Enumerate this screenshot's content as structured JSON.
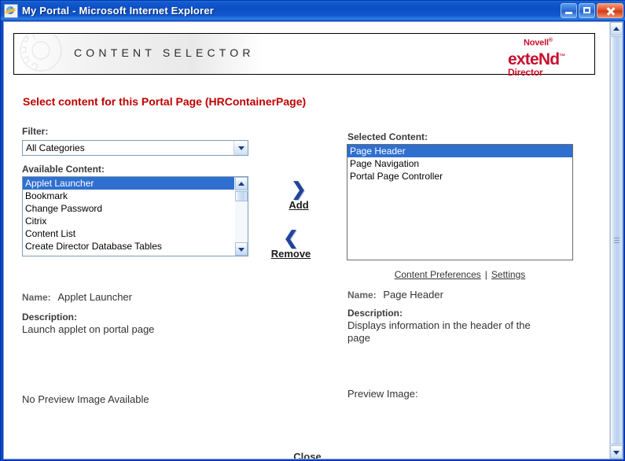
{
  "window": {
    "title": "My Portal - Microsoft Internet Explorer",
    "icon": "ie-document-icon",
    "buttons": {
      "minimize": "Minimize",
      "maximize": "Maximize",
      "close": "Close"
    }
  },
  "banner": {
    "title": "CONTENT SELECTOR",
    "logo": {
      "brand": "Novell",
      "brand_mark": "®",
      "product": "exteNd",
      "product_mark": "™",
      "suite": "Director"
    }
  },
  "heading": "Select content for this Portal Page (HRContainerPage)",
  "filter": {
    "label": "Filter:",
    "selected": "All Categories",
    "options": [
      "All Categories"
    ]
  },
  "available": {
    "label": "Available Content:",
    "items": [
      "Applet Launcher",
      "Bookmark",
      "Change Password",
      "Citrix",
      "Content List",
      "Create Director Database Tables"
    ],
    "selected_index": 0
  },
  "selected": {
    "label": "Selected Content:",
    "items": [
      "Page Header",
      "Page Navigation",
      "Portal Page Controller"
    ],
    "selected_index": 0
  },
  "transfer": {
    "add_label": "Add",
    "add_icon": "chevron-right-icon",
    "remove_label": "Remove",
    "remove_icon": "chevron-left-icon"
  },
  "links": {
    "content_preferences": "Content Preferences",
    "separator": "|",
    "settings": "Settings"
  },
  "left_detail": {
    "name_label": "Name:",
    "name_value": "Applet Launcher",
    "description_label": "Description:",
    "description_value": "Launch applet on portal page",
    "preview": "No Preview Image Available"
  },
  "right_detail": {
    "name_label": "Name:",
    "name_value": "Page Header",
    "description_label": "Description:",
    "description_value": "Displays information in the header of the page",
    "preview_label": "Preview Image:"
  },
  "footer": {
    "close_label": "Close"
  },
  "colors": {
    "titlebar_blue": "#0d4ec4",
    "heading_red": "#c00000",
    "logo_red": "#c8102e",
    "selection_blue": "#2f6fd0"
  }
}
